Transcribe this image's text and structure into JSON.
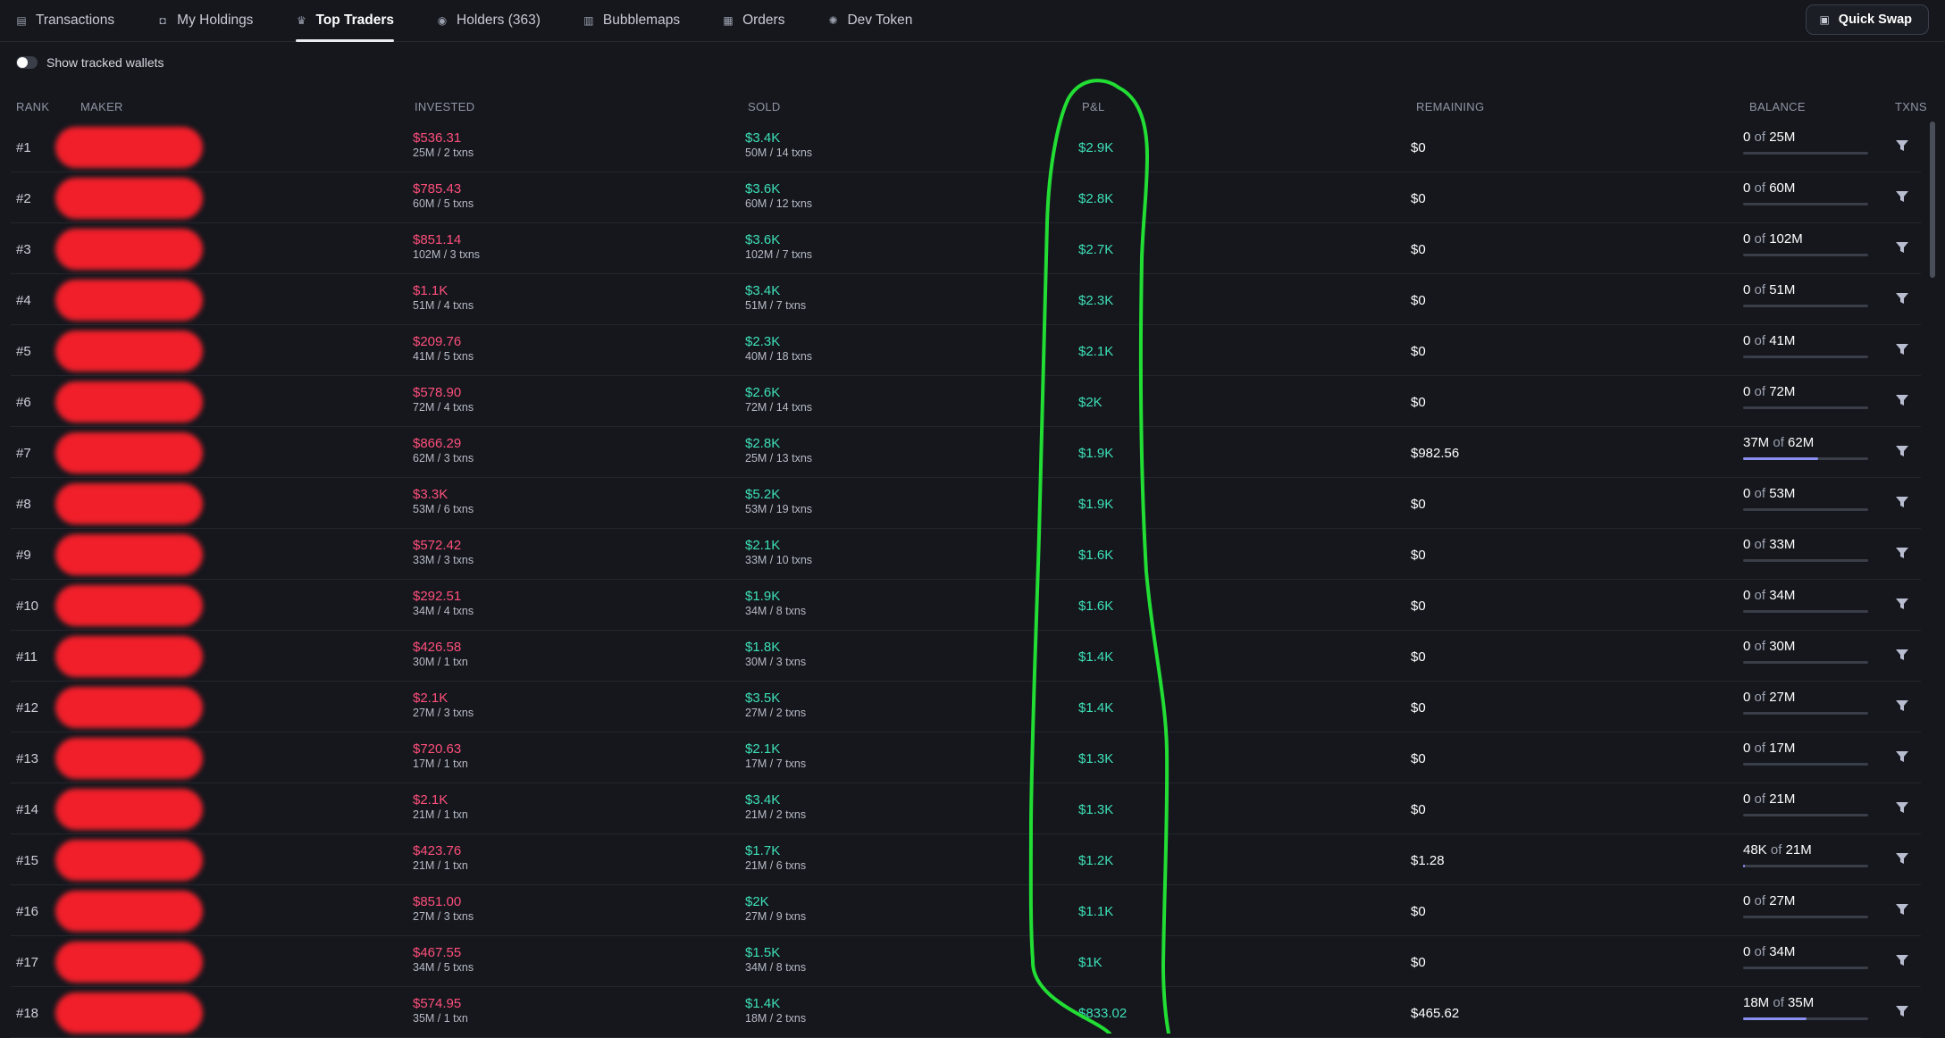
{
  "tabs": [
    {
      "label": "Transactions",
      "icon": "receipt-icon",
      "active": false
    },
    {
      "label": "My Holdings",
      "icon": "wallet-icon",
      "active": false
    },
    {
      "label": "Top Traders",
      "icon": "crown-icon",
      "active": true
    },
    {
      "label": "Holders (363)",
      "icon": "coins-icon",
      "active": false
    },
    {
      "label": "Bubblemaps",
      "icon": "map-icon",
      "active": false
    },
    {
      "label": "Orders",
      "icon": "cart-icon",
      "active": false
    },
    {
      "label": "Dev Token",
      "icon": "gear-icon",
      "active": false
    }
  ],
  "quick_swap": {
    "label": "Quick Swap",
    "icon": "swap-icon"
  },
  "toggle": {
    "label": "Show tracked wallets",
    "on": false
  },
  "columns": {
    "rank": "RANK",
    "maker": "MAKER",
    "invested": "INVESTED",
    "sold": "SOLD",
    "pnl": "P&L",
    "remaining": "REMAINING",
    "balance": "BALANCE",
    "txns": "TXNS"
  },
  "balance_of": "of",
  "rows": [
    {
      "rank": "#1",
      "invested": "$536.31",
      "invested_sub": "25M / 2 txns",
      "sold": "$3.4K",
      "sold_sub": "50M / 14 txns",
      "pnl": "$2.9K",
      "remaining": "$0",
      "bal_held": "0",
      "bal_total": "25M",
      "bal_frac": 0
    },
    {
      "rank": "#2",
      "invested": "$785.43",
      "invested_sub": "60M / 5 txns",
      "sold": "$3.6K",
      "sold_sub": "60M / 12 txns",
      "pnl": "$2.8K",
      "remaining": "$0",
      "bal_held": "0",
      "bal_total": "60M",
      "bal_frac": 0
    },
    {
      "rank": "#3",
      "invested": "$851.14",
      "invested_sub": "102M / 3 txns",
      "sold": "$3.6K",
      "sold_sub": "102M / 7 txns",
      "pnl": "$2.7K",
      "remaining": "$0",
      "bal_held": "0",
      "bal_total": "102M",
      "bal_frac": 0
    },
    {
      "rank": "#4",
      "invested": "$1.1K",
      "invested_sub": "51M / 4 txns",
      "sold": "$3.4K",
      "sold_sub": "51M / 7 txns",
      "pnl": "$2.3K",
      "remaining": "$0",
      "bal_held": "0",
      "bal_total": "51M",
      "bal_frac": 0
    },
    {
      "rank": "#5",
      "invested": "$209.76",
      "invested_sub": "41M / 5 txns",
      "sold": "$2.3K",
      "sold_sub": "40M / 18 txns",
      "pnl": "$2.1K",
      "remaining": "$0",
      "bal_held": "0",
      "bal_total": "41M",
      "bal_frac": 0
    },
    {
      "rank": "#6",
      "invested": "$578.90",
      "invested_sub": "72M / 4 txns",
      "sold": "$2.6K",
      "sold_sub": "72M / 14 txns",
      "pnl": "$2K",
      "remaining": "$0",
      "bal_held": "0",
      "bal_total": "72M",
      "bal_frac": 0
    },
    {
      "rank": "#7",
      "invested": "$866.29",
      "invested_sub": "62M / 3 txns",
      "sold": "$2.8K",
      "sold_sub": "25M / 13 txns",
      "pnl": "$1.9K",
      "remaining": "$982.56",
      "bal_held": "37M",
      "bal_total": "62M",
      "bal_frac": 0.6
    },
    {
      "rank": "#8",
      "invested": "$3.3K",
      "invested_sub": "53M / 6 txns",
      "sold": "$5.2K",
      "sold_sub": "53M / 19 txns",
      "pnl": "$1.9K",
      "remaining": "$0",
      "bal_held": "0",
      "bal_total": "53M",
      "bal_frac": 0
    },
    {
      "rank": "#9",
      "invested": "$572.42",
      "invested_sub": "33M / 3 txns",
      "sold": "$2.1K",
      "sold_sub": "33M / 10 txns",
      "pnl": "$1.6K",
      "remaining": "$0",
      "bal_held": "0",
      "bal_total": "33M",
      "bal_frac": 0
    },
    {
      "rank": "#10",
      "invested": "$292.51",
      "invested_sub": "34M / 4 txns",
      "sold": "$1.9K",
      "sold_sub": "34M / 8 txns",
      "pnl": "$1.6K",
      "remaining": "$0",
      "bal_held": "0",
      "bal_total": "34M",
      "bal_frac": 0
    },
    {
      "rank": "#11",
      "invested": "$426.58",
      "invested_sub": "30M / 1 txn",
      "sold": "$1.8K",
      "sold_sub": "30M / 3 txns",
      "pnl": "$1.4K",
      "remaining": "$0",
      "bal_held": "0",
      "bal_total": "30M",
      "bal_frac": 0
    },
    {
      "rank": "#12",
      "invested": "$2.1K",
      "invested_sub": "27M / 3 txns",
      "sold": "$3.5K",
      "sold_sub": "27M / 2 txns",
      "pnl": "$1.4K",
      "remaining": "$0",
      "bal_held": "0",
      "bal_total": "27M",
      "bal_frac": 0
    },
    {
      "rank": "#13",
      "invested": "$720.63",
      "invested_sub": "17M / 1 txn",
      "sold": "$2.1K",
      "sold_sub": "17M / 7 txns",
      "pnl": "$1.3K",
      "remaining": "$0",
      "bal_held": "0",
      "bal_total": "17M",
      "bal_frac": 0
    },
    {
      "rank": "#14",
      "invested": "$2.1K",
      "invested_sub": "21M / 1 txn",
      "sold": "$3.4K",
      "sold_sub": "21M / 2 txns",
      "pnl": "$1.3K",
      "remaining": "$0",
      "bal_held": "0",
      "bal_total": "21M",
      "bal_frac": 0
    },
    {
      "rank": "#15",
      "invested": "$423.76",
      "invested_sub": "21M / 1 txn",
      "sold": "$1.7K",
      "sold_sub": "21M / 6 txns",
      "pnl": "$1.2K",
      "remaining": "$1.28",
      "bal_held": "48K",
      "bal_total": "21M",
      "bal_frac": 0.002
    },
    {
      "rank": "#16",
      "invested": "$851.00",
      "invested_sub": "27M / 3 txns",
      "sold": "$2K",
      "sold_sub": "27M / 9 txns",
      "pnl": "$1.1K",
      "remaining": "$0",
      "bal_held": "0",
      "bal_total": "27M",
      "bal_frac": 0
    },
    {
      "rank": "#17",
      "invested": "$467.55",
      "invested_sub": "34M / 5 txns",
      "sold": "$1.5K",
      "sold_sub": "34M / 8 txns",
      "pnl": "$1K",
      "remaining": "$0",
      "bal_held": "0",
      "bal_total": "34M",
      "bal_frac": 0
    },
    {
      "rank": "#18",
      "invested": "$574.95",
      "invested_sub": "35M / 1 txn",
      "sold": "$1.4K",
      "sold_sub": "18M / 2 txns",
      "pnl": "$833.02",
      "remaining": "$465.62",
      "bal_held": "18M",
      "bal_total": "35M",
      "bal_frac": 0.51
    }
  ],
  "colors": {
    "background": "#15171d",
    "invested": "#ff4f7b",
    "profit": "#3ee0b6",
    "redaction": "#f01f2a",
    "annotation": "#22dd33",
    "balance_fill": "#8a8ff0"
  }
}
